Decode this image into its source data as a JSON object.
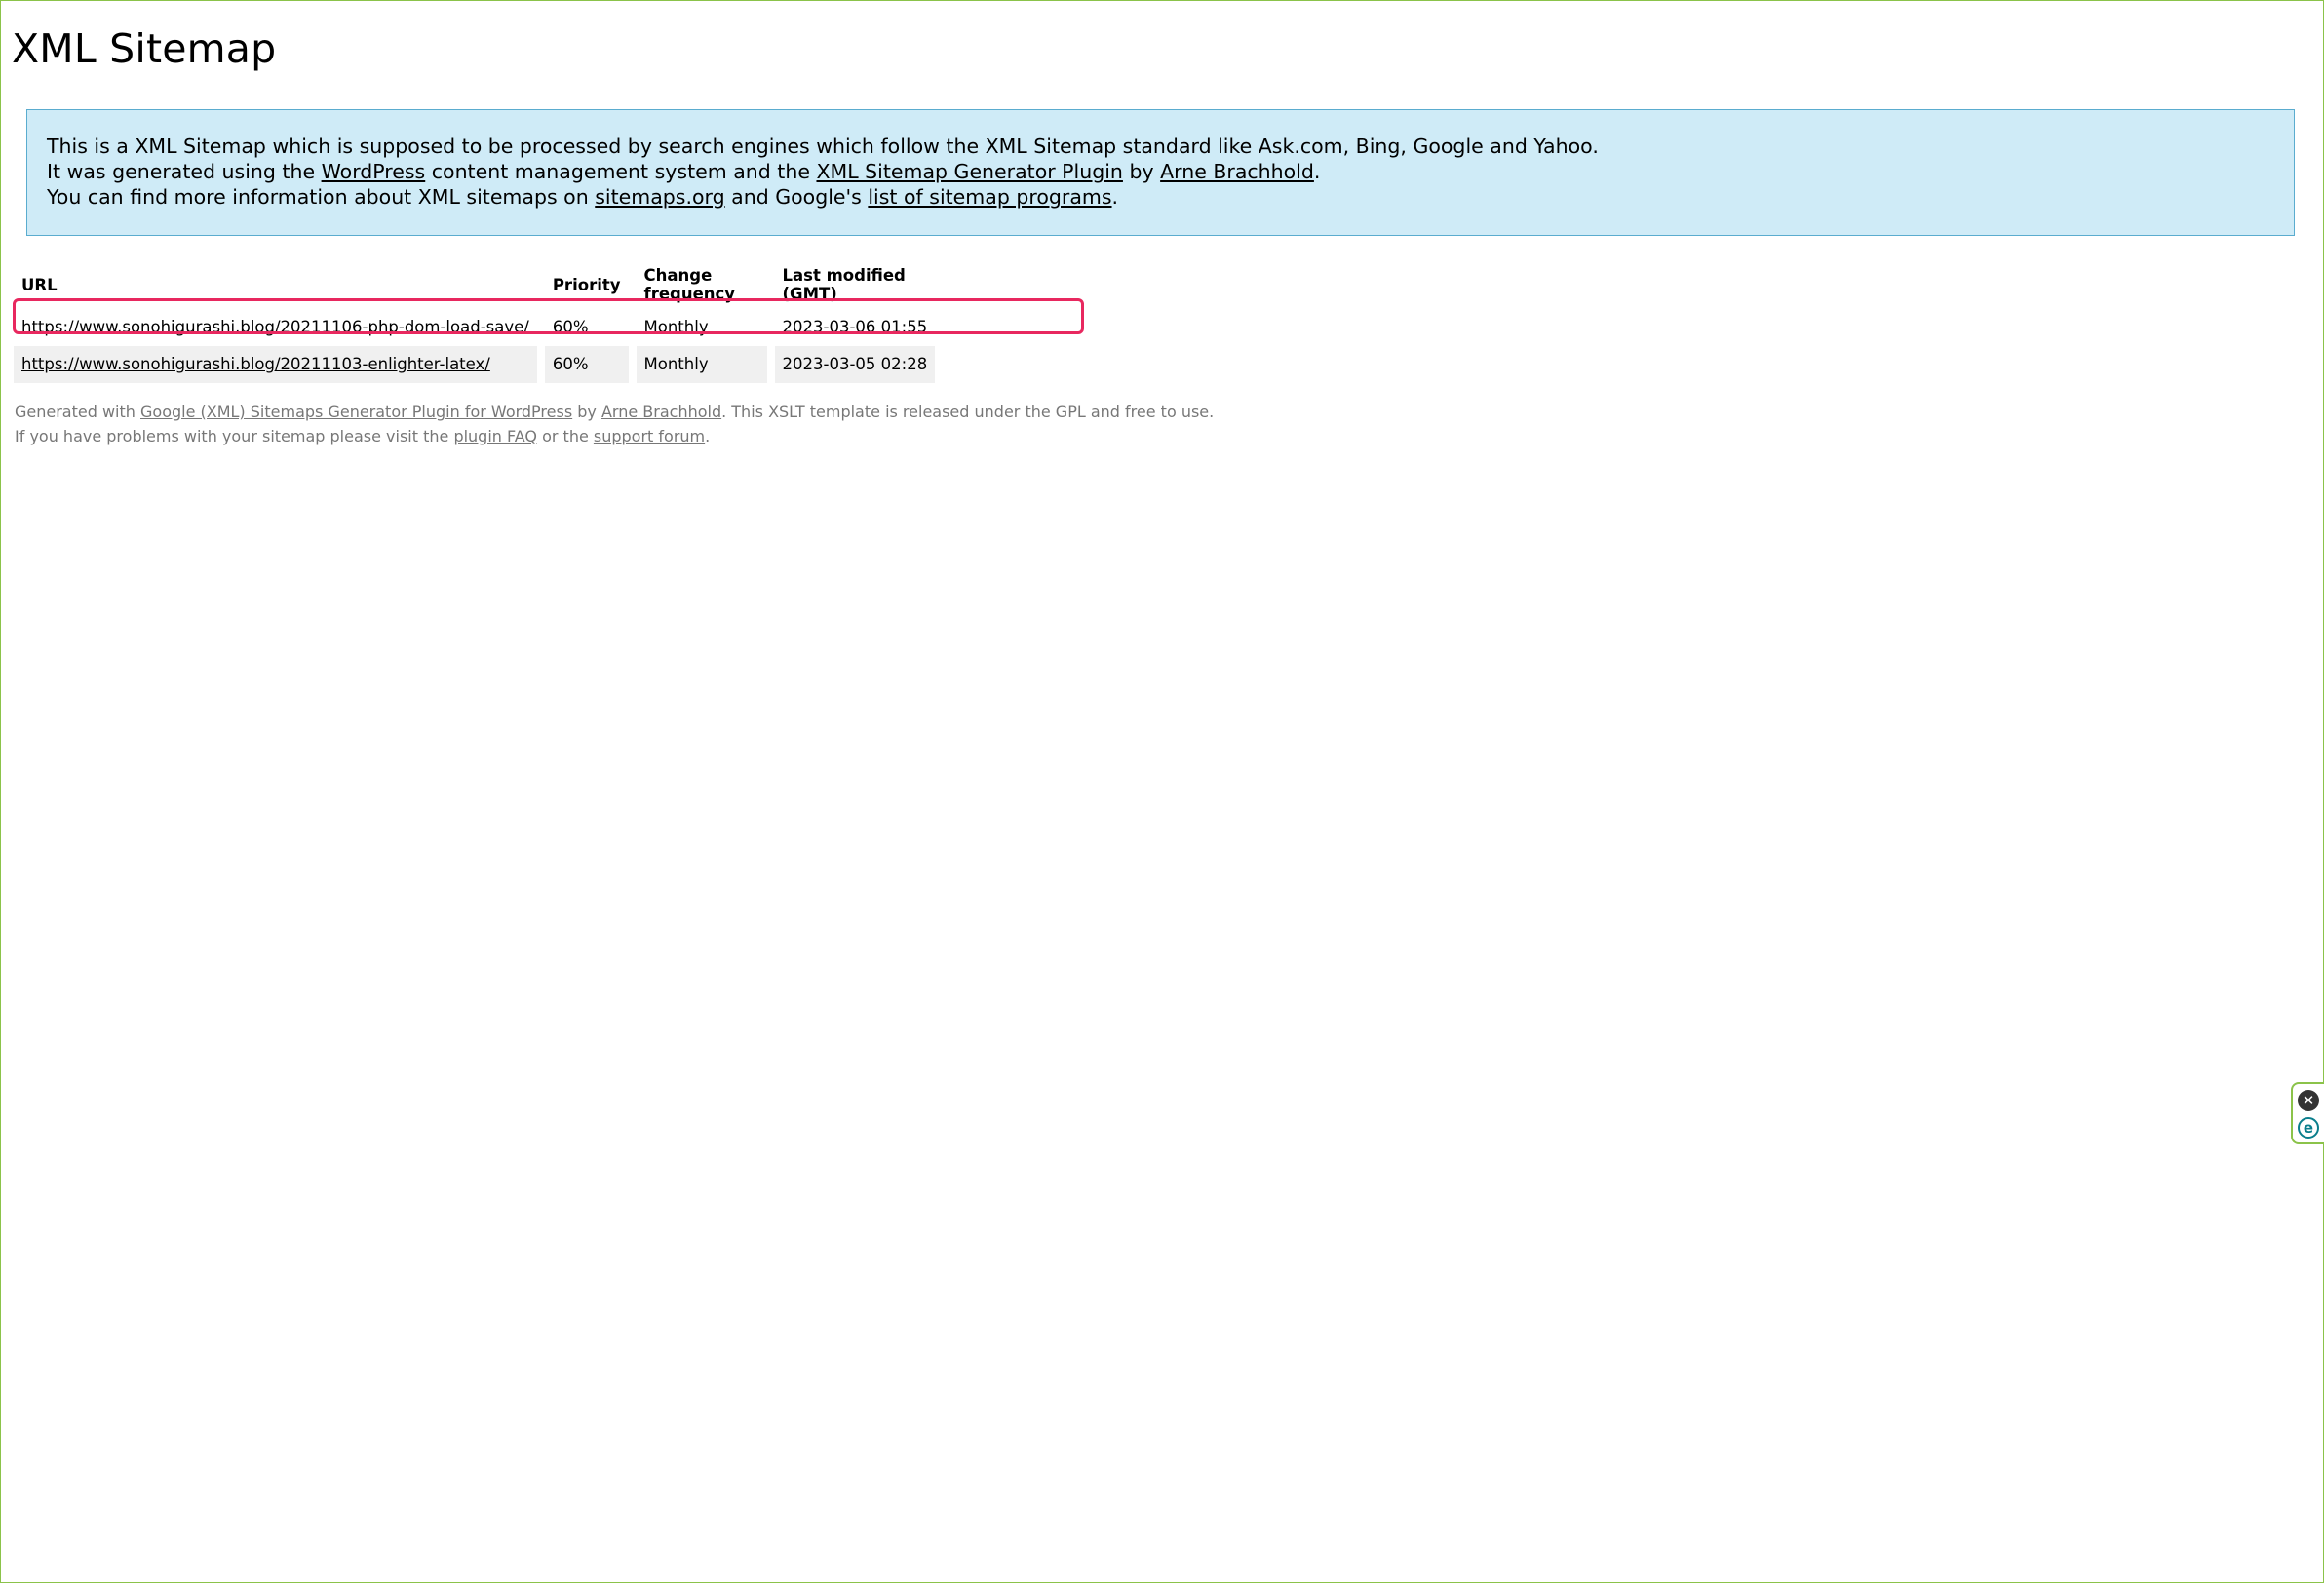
{
  "page": {
    "title": "XML Sitemap"
  },
  "intro": {
    "line1": "This is a XML Sitemap which is supposed to be processed by search engines which follow the XML Sitemap standard like Ask.com, Bing, Google and Yahoo.",
    "line2_a": "It was generated using the ",
    "line2_link1": "WordPress",
    "line2_b": " content management system and the ",
    "line2_link2": "XML Sitemap Generator Plugin",
    "line2_c": " by ",
    "line2_link3": "Arne Brachhold",
    "line2_d": ".",
    "line3_a": "You can find more information about XML sitemaps on ",
    "line3_link1": "sitemaps.org",
    "line3_b": " and Google's ",
    "line3_link2": "list of sitemap programs",
    "line3_c": "."
  },
  "table": {
    "headers": {
      "url": "URL",
      "priority": "Priority",
      "change_frequency": "Change frequency",
      "last_modified": "Last modified (GMT)"
    },
    "rows": [
      {
        "url": "https://www.sonohigurashi.blog/20211106-php-dom-load-save/",
        "priority": "60%",
        "change_frequency": "Monthly",
        "last_modified": "2023-03-06 01:55",
        "highlighted": true
      },
      {
        "url": "https://www.sonohigurashi.blog/20211103-enlighter-latex/",
        "priority": "60%",
        "change_frequency": "Monthly",
        "last_modified": "2023-03-05 02:28",
        "highlighted": false
      }
    ]
  },
  "footer": {
    "line1_a": "Generated with ",
    "line1_link1": "Google (XML) Sitemaps Generator Plugin for WordPress",
    "line1_b": " by ",
    "line1_link2": "Arne Brachhold",
    "line1_c": ". This XSLT template is released under the GPL and free to use.",
    "line2_a": "If you have problems with your sitemap please visit the ",
    "line2_link1": "plugin FAQ",
    "line2_b": " or the ",
    "line2_link2": "support forum",
    "line2_c": "."
  },
  "widget": {
    "close_icon": "close-icon",
    "e_icon": "e-icon",
    "e_label": "e",
    "close_label": "✕"
  },
  "colors": {
    "intro_bg": "#cfebf7",
    "intro_border": "#5aaccf",
    "highlight": "#e8285f",
    "frame": "#8bc34a",
    "footer_text": "#777777"
  }
}
